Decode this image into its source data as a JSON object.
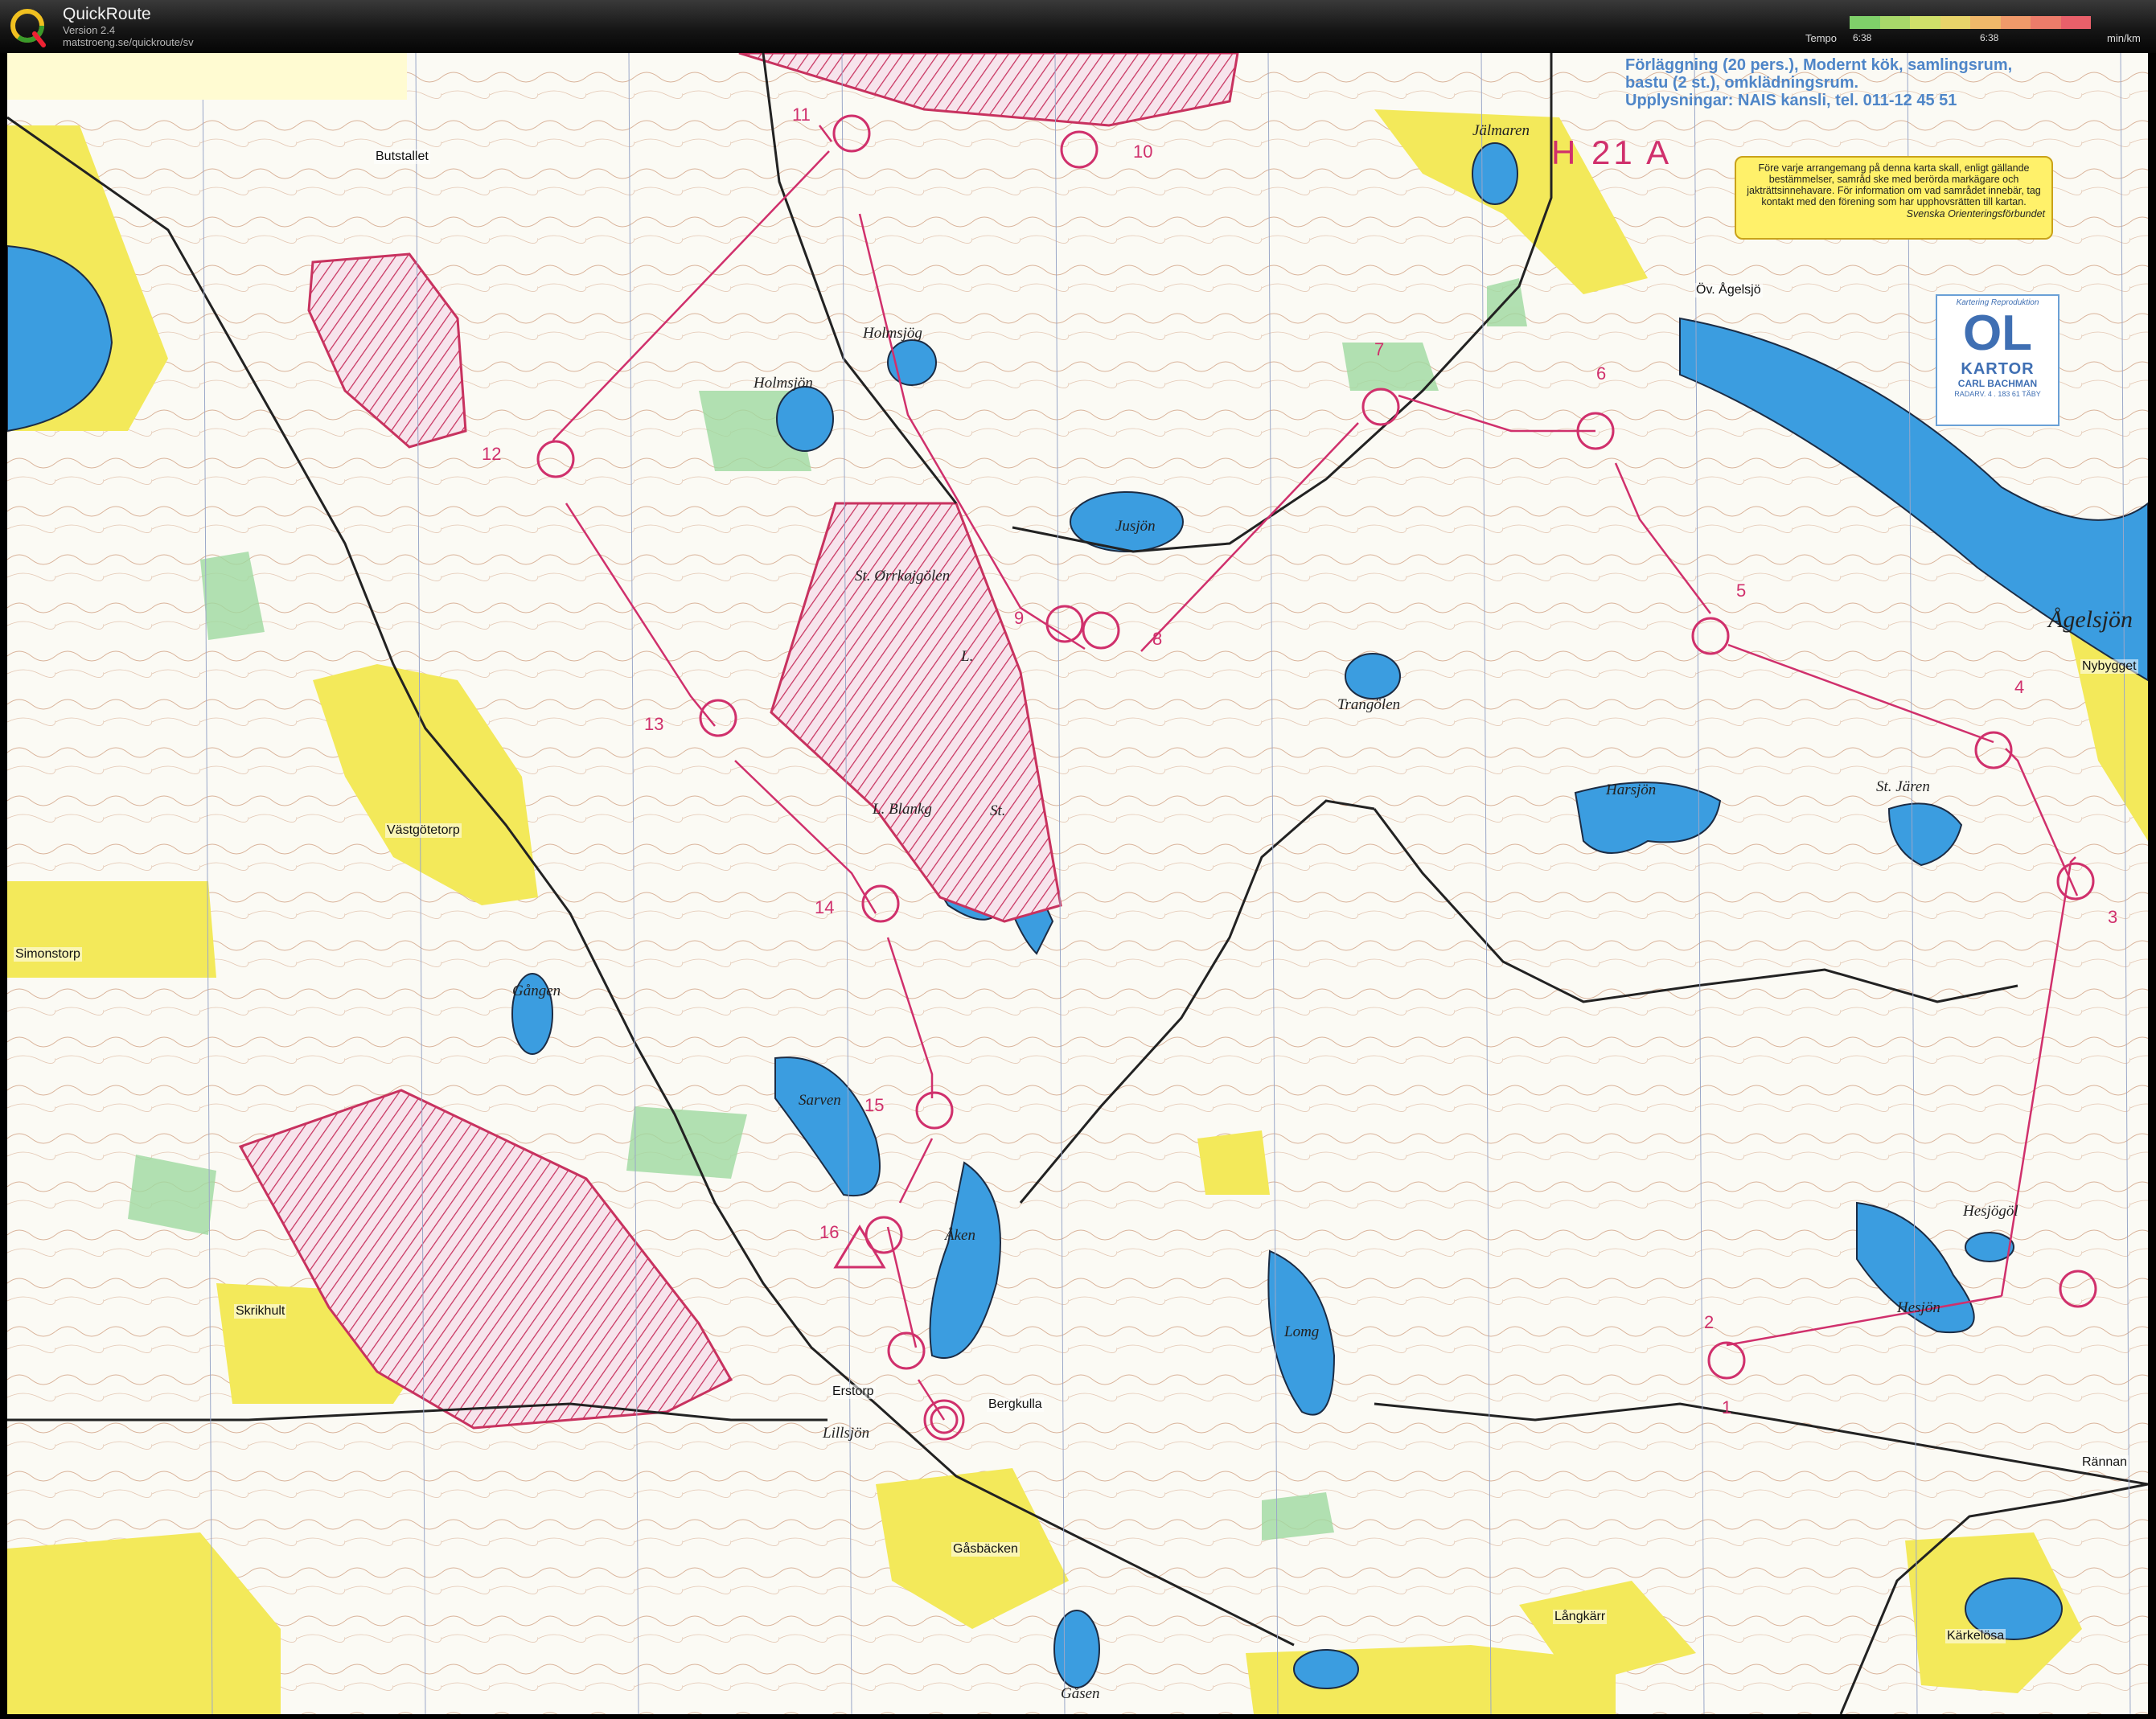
{
  "app": {
    "name": "QuickRoute",
    "version": "Version 2.4",
    "url": "matstroeng.se/quickroute/sv"
  },
  "tempo_bar": {
    "label": "Tempo",
    "min": "6:38",
    "max": "6:38",
    "unit": "min/km",
    "colors": [
      "#7fd06a",
      "#a8d86a",
      "#cfe06a",
      "#e8d46a",
      "#f0b86a",
      "#f09a6a",
      "#ec7c6a",
      "#e8606a"
    ]
  },
  "map": {
    "info_text": [
      "Förläggning (20 pers.), Modernt kök, samlingsrum,",
      "bastu (2 st.), omklädningsrum.",
      "Upplysningar: NAIS kansli, tel. 011-12 45 51"
    ],
    "class_label": "H 21 A",
    "notice": {
      "text": "Före varje arrangemang på denna karta skall, enligt gällande bestämmelser, samråd ske med berörda markägare och jakträttsinnehavare. För information om vad samrådet innebär, tag kontakt med den förening som har upphovsrätten till kartan.",
      "signature": "Svenska Orienteringsförbundet"
    },
    "logo": {
      "top": "Kartering   Reproduktion",
      "mark": "OL",
      "name": "KARTOR",
      "sub": "CARL BACHMAN",
      "addr": "RADARV. 4 . 183 61 TÄBY"
    },
    "place_labels": {
      "butstallet": "Butstallet",
      "jalmaren": "Jälmaren",
      "ov_agelsjo": "Öv. Ågelsjö",
      "holmsjog": "Holmsjög",
      "holmsjon": "Holmsjön",
      "jusjon": "Jusjön",
      "st_orrkojgolen": "St. Ørrkøjgölen",
      "agelsjon": "Ågelsjön",
      "nybygget": "Nybygget",
      "trangolen": "Trangölen",
      "vastgotetorp": "Västgötetorp",
      "l_blankg": "L. Blankg",
      "st": "St.",
      "l": "L.",
      "harsjon": "Harsjön",
      "st_jaren": "St. Jären",
      "simonstorp": "Simonstorp",
      "gangen": "Gången",
      "sarven": "Sarven",
      "aken": "Åken",
      "hesjogol": "Hesjögöl",
      "hesjon": "Hesjön",
      "skrikhult": "Skrikhult",
      "lomg": "Lomg",
      "erstorp": "Erstorp",
      "bergkulla": "Bergkulla",
      "lillsjon": "Lillsjön",
      "rannan": "Rännan",
      "gasbacken": "Gåsbäcken",
      "langkarr": "Långkärr",
      "karkelosa": "Kärkelösa",
      "gasen": "Gåsen"
    },
    "controls": [
      "1",
      "2",
      "3",
      "4",
      "5",
      "6",
      "7",
      "8",
      "9",
      "10",
      "11",
      "12",
      "13",
      "14",
      "15",
      "16"
    ]
  }
}
